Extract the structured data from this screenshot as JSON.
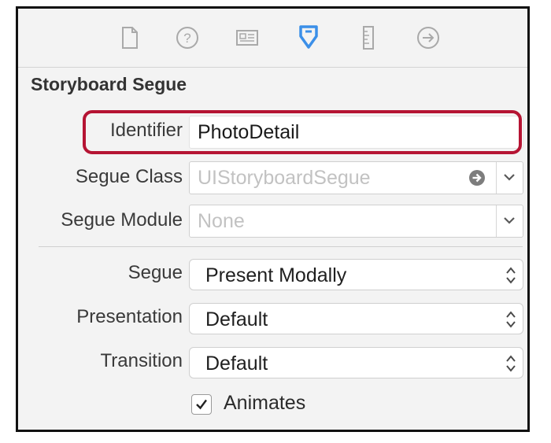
{
  "toolbar": {
    "icons": [
      "file-inspector-icon",
      "quick-help-icon",
      "identity-inspector-icon",
      "attributes-inspector-icon",
      "size-inspector-icon",
      "connections-inspector-icon"
    ],
    "active_index": 3,
    "active_color": "#3b8fe8",
    "inactive_color": "#a9a9a9"
  },
  "section": {
    "title": "Storyboard Segue"
  },
  "identifier": {
    "label": "Identifier",
    "value": "PhotoDetail",
    "highlight_color": "#b51433"
  },
  "segue_class": {
    "label": "Segue Class",
    "placeholder": "UIStoryboardSegue"
  },
  "segue_module": {
    "label": "Segue Module",
    "placeholder": "None"
  },
  "segue": {
    "label": "Segue",
    "selected": "Present Modally"
  },
  "presentation": {
    "label": "Presentation",
    "selected": "Default"
  },
  "transition": {
    "label": "Transition",
    "selected": "Default"
  },
  "animates": {
    "label": "Animates",
    "checked": true
  }
}
